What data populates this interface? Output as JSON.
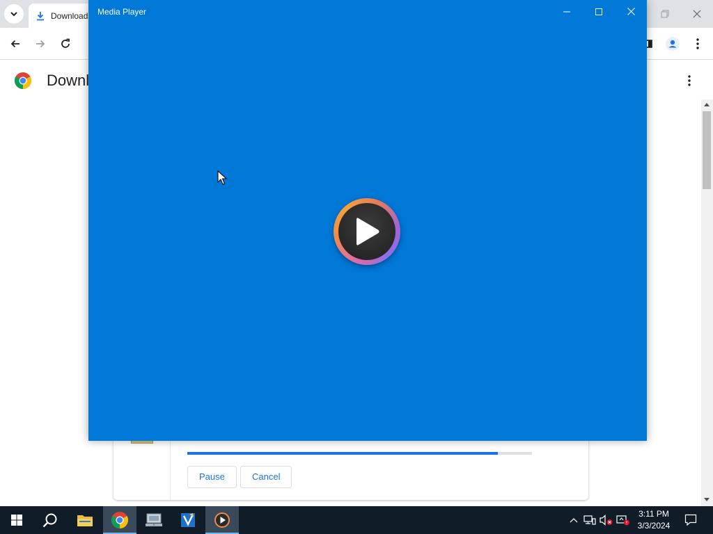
{
  "browser": {
    "tab_title": "Downloads",
    "page_title": "Downloads"
  },
  "download": {
    "progress": 0.9,
    "pause_label": "Pause",
    "cancel_label": "Cancel"
  },
  "media_player": {
    "title": "Media Player",
    "background_color": "#0078d7"
  },
  "taskbar": {
    "apps": [
      "start-icon",
      "search-icon",
      "file-explorer-icon",
      "chrome-icon",
      "network-drive-icon",
      "text-editor-icon",
      "media-player-icon"
    ],
    "active_app": "media-player-icon",
    "time": "3:11 PM",
    "date": "3/3/2024"
  }
}
